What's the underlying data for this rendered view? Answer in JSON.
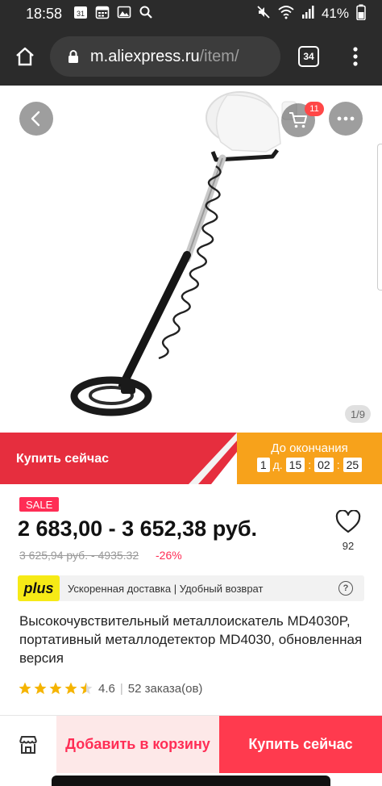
{
  "status_bar": {
    "time": "18:58",
    "calendar_day": "31",
    "battery": "41%",
    "icons": [
      "calendar-icon",
      "calendar-grid-icon",
      "gallery-icon",
      "search-icon",
      "mute-icon",
      "wifi-icon",
      "signal-icon",
      "battery-icon"
    ]
  },
  "browser": {
    "url_domain": "m.aliexpress.ru",
    "url_path": "/item/",
    "tab_count": "34"
  },
  "gallery": {
    "image_counter": "1/9",
    "cart_count": "11"
  },
  "promo": {
    "buy_now_label": "Купить сейчас",
    "countdown_title": "До окончания",
    "days": "1",
    "days_unit": "д.",
    "hours": "15",
    "minutes": "02",
    "seconds": "25",
    "colors": {
      "red": "#e62e3e",
      "orange": "#f7a21b"
    }
  },
  "price": {
    "sale_badge": "SALE",
    "current": "2 683,00 - 3 652,38 руб.",
    "old": "3 625,94 руб. - 4935.32",
    "discount": "-26%",
    "wishlist_count": "92"
  },
  "delivery": {
    "logo": "plus",
    "text": "Ускоренная доставка | Удобный возврат"
  },
  "product": {
    "title": "Высокочувствительный металлоискатель MD4030P, портативный металлодетектор MD4030, обновленная версия",
    "rating": "4.6",
    "orders": "52 заказа(ов)",
    "stars_filled": 4.5
  },
  "bottom_bar": {
    "add_to_cart_label": "Добавить в корзину",
    "buy_now_label": "Купить сейчас"
  }
}
